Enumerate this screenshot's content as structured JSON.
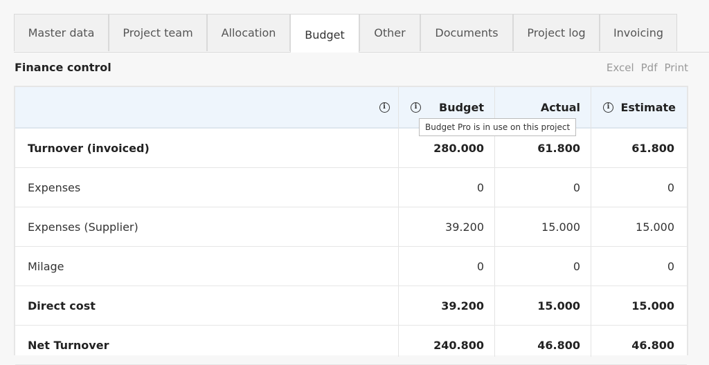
{
  "tabs": [
    {
      "label": "Master data",
      "active": false
    },
    {
      "label": "Project team",
      "active": false
    },
    {
      "label": "Allocation",
      "active": false
    },
    {
      "label": "Budget",
      "active": true
    },
    {
      "label": "Other",
      "active": false
    },
    {
      "label": "Documents",
      "active": false
    },
    {
      "label": "Project log",
      "active": false
    },
    {
      "label": "Invoicing",
      "active": false
    }
  ],
  "section": {
    "title": "Finance control",
    "exports": {
      "excel": "Excel",
      "pdf": "Pdf",
      "print": "Print"
    }
  },
  "table": {
    "headers": {
      "budget": "Budget",
      "actual": "Actual",
      "estimate": "Estimate"
    },
    "tooltip": "Budget Pro is in use on this project",
    "rows": [
      {
        "label": "Turnover (invoiced)",
        "budget": "280.000",
        "actual": "61.800",
        "estimate": "61.800",
        "bold": true
      },
      {
        "label": "Expenses",
        "budget": "0",
        "actual": "0",
        "estimate": "0",
        "bold": false
      },
      {
        "label": "Expenses (Supplier)",
        "budget": "39.200",
        "actual": "15.000",
        "estimate": "15.000",
        "bold": false
      },
      {
        "label": "Milage",
        "budget": "0",
        "actual": "0",
        "estimate": "0",
        "bold": false
      },
      {
        "label": "Direct cost",
        "budget": "39.200",
        "actual": "15.000",
        "estimate": "15.000",
        "bold": true
      },
      {
        "label": "Net Turnover",
        "budget": "240.800",
        "actual": "46.800",
        "estimate": "46.800",
        "bold": true
      }
    ]
  },
  "icons": {
    "info": "info-circle-icon"
  }
}
